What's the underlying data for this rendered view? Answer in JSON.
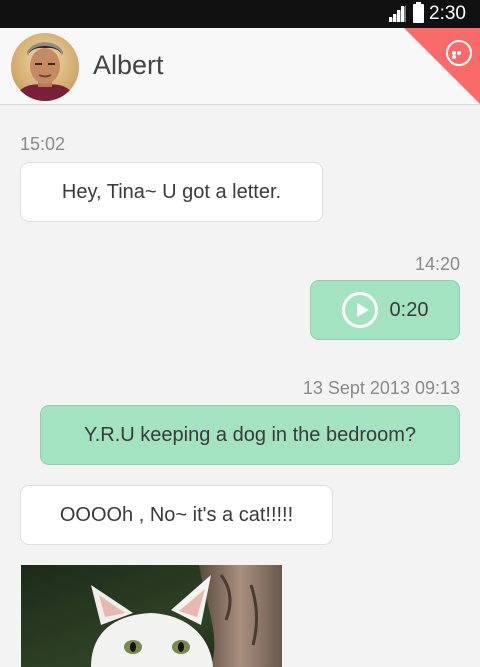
{
  "status_bar": {
    "time": "2:30",
    "icons": [
      "signal-icon",
      "battery-icon"
    ]
  },
  "header": {
    "contact_name": "Albert",
    "accent_color": "#f96a6a",
    "menu_icon": "more-options-icon"
  },
  "messages": [
    {
      "direction": "incoming",
      "timestamp": "15:02",
      "type": "text",
      "text": "Hey, Tina~ U got a letter."
    },
    {
      "direction": "outgoing",
      "timestamp": "14:20",
      "type": "voice",
      "duration": "0:20"
    },
    {
      "direction": "outgoing",
      "timestamp": "13 Sept 2013 09:13",
      "type": "text",
      "text": "Y.R.U keeping a dog in the bedroom?"
    },
    {
      "direction": "incoming",
      "type": "text",
      "text": "OOOOh , No~ it's a cat!!!!!"
    },
    {
      "direction": "incoming",
      "type": "image",
      "image": "white-kitten-photo"
    }
  ],
  "colors": {
    "outgoing_bubble": "#a3e3c2",
    "incoming_bubble": "#ffffff",
    "background": "#f3f3f3"
  }
}
